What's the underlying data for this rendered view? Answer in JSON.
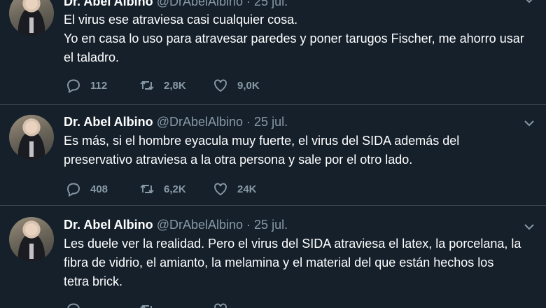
{
  "tweets": [
    {
      "name": "Dr. Abel Albino",
      "handle": "@DrAbelAlbino",
      "dot": "·",
      "date": "25 jul.",
      "text_lines": [
        "El virus ese atraviesa casi cualquier cosa.",
        "Yo en casa lo uso para atravesar paredes y poner tarugos Fischer, me ahorro usar",
        "el taladro."
      ],
      "replies": "112",
      "retweets": "2,8K",
      "likes": "9,0K"
    },
    {
      "name": "Dr. Abel Albino",
      "handle": "@DrAbelAlbino",
      "dot": "·",
      "date": "25 jul.",
      "text_lines": [
        "Es más, si el hombre eyacula muy fuerte, el virus del SIDA además del",
        "preservativo atraviesa a la otra persona y sale por el otro lado."
      ],
      "replies": "408",
      "retweets": "6,2K",
      "likes": "24K"
    },
    {
      "name": "Dr. Abel Albino",
      "handle": "@DrAbelAlbino",
      "dot": "·",
      "date": "25 jul.",
      "text_lines": [
        "Les duele ver la realidad. Pero el virus del SIDA atraviesa el latex, la porcelana, la",
        "fibra de vidrio, el amianto, la melamina y el material del que están hechos los",
        "tetra brick."
      ],
      "replies": "",
      "retweets": "",
      "likes": ""
    }
  ],
  "icons": {
    "reply": "reply-icon",
    "retweet": "retweet-icon",
    "like": "heart-icon",
    "caret": "chevron-down-icon"
  },
  "colors": {
    "background": "#15202b",
    "secondary_text": "#8899a6",
    "divider": "#38444d"
  }
}
